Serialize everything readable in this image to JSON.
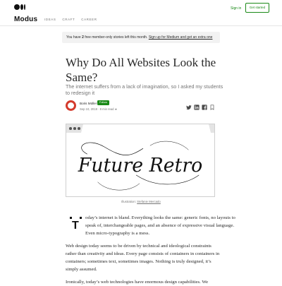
{
  "header": {
    "brand": "Modus",
    "nav": [
      "IDEAS",
      "CRAFT",
      "CAREER"
    ],
    "sign_in": "Sign in",
    "get_started": "Get started"
  },
  "banner": {
    "prefix": "You have ",
    "count": "2",
    "middle": " free member-only stories left this month. ",
    "link": "Sign up for Medium and get an extra one"
  },
  "article": {
    "title": "Why Do All Websites Look the Same?",
    "subtitle": "The internet suffers from a lack of imagination, so I asked my students to redesign it",
    "author": "Boris Müller",
    "follow_label": "Follow",
    "date": "Sep 10, 2018",
    "read_time": "8 min read",
    "star": "★",
    "caption_prefix": "Illustration: ",
    "caption_credit": "Stefanie Mercado",
    "drop_cap": "T",
    "paragraph_1": "oday’s internet is bland. Everything looks the same: generic fonts, no layouts to speak of, interchangeable pages, and an absence of expressive visual language. Even micro-typography is a mess.",
    "paragraph_2": "Web design today seems to be driven by technical and ideological constraints rather than creativity and ideas. Every page consists of containers in containers in containers; sometimes text, sometimes images. Nothing is truly designed, it’s simply assumed.",
    "paragraph_3": "Ironically, today’s web technologies have enormous design capabilities. We"
  },
  "illustration": {
    "lettering": "Future Retro"
  },
  "icons": [
    "medium-logo-icon",
    "twitter-icon",
    "linkedin-icon",
    "facebook-icon",
    "bookmark-icon"
  ],
  "colors": {
    "accent": "#1a8917",
    "avatar_ring": "#d43a2c",
    "text": "#292929",
    "muted": "#757575"
  }
}
